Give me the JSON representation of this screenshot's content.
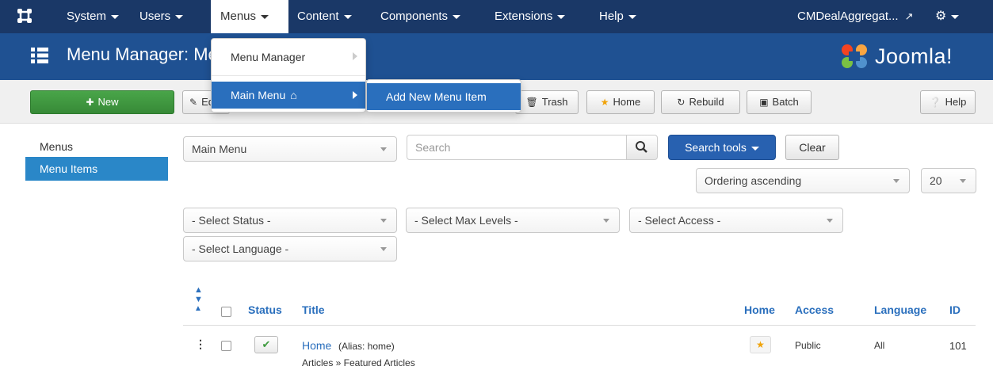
{
  "navbar": {
    "items": [
      {
        "label": "System"
      },
      {
        "label": "Users"
      },
      {
        "label": "Menus"
      },
      {
        "label": "Content"
      },
      {
        "label": "Components"
      },
      {
        "label": "Extensions"
      },
      {
        "label": "Help"
      }
    ],
    "site_link": "CMDealAggregat...",
    "accent": "#1a3867"
  },
  "subhead": {
    "title": "Menu Manager: Menu Items",
    "logo_text": "Joomla!",
    "color": "#1f5192"
  },
  "menus_dropdown": {
    "items": [
      "Menu Manager",
      "Main Menu"
    ],
    "submenu": [
      "Add New Menu Item"
    ]
  },
  "toolbar": {
    "new": "New",
    "edit": "Edit",
    "trash": "Trash",
    "home": "Home",
    "rebuild": "Rebuild",
    "batch": "Batch",
    "help": "Help"
  },
  "sidebar": {
    "items": [
      {
        "label": "Menus",
        "active": false
      },
      {
        "label": "Menu Items",
        "active": true
      }
    ]
  },
  "filters": {
    "menu_select": "Main Menu",
    "search_placeholder": "Search",
    "search_tools": "Search tools",
    "clear": "Clear",
    "ordering": "Ordering ascending",
    "limit": "20",
    "status": "- Select Status -",
    "max_levels": "- Select Max Levels -",
    "access": "- Select Access -",
    "language": "- Select Language -"
  },
  "table": {
    "headers": {
      "status": "Status",
      "title": "Title",
      "home": "Home",
      "access": "Access",
      "language": "Language",
      "id": "ID"
    },
    "rows": [
      {
        "title": "Home",
        "alias": "(Alias: home)",
        "type": "Articles » Featured Articles",
        "access": "Public",
        "language": "All",
        "id": "101"
      }
    ]
  }
}
